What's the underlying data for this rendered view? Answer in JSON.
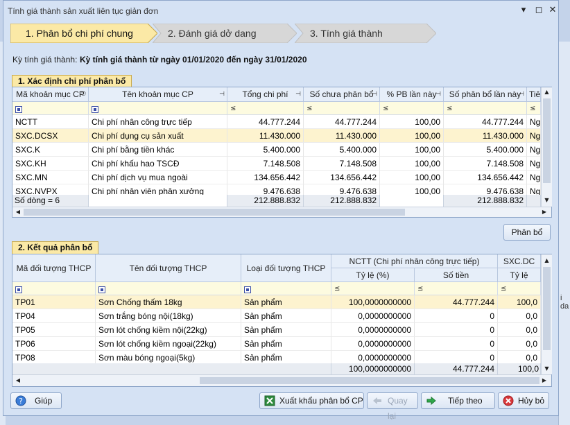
{
  "window": {
    "title": "Tính giá thành sản xuất liên tục giản đơn"
  },
  "steps": [
    {
      "label": "1. Phân bổ chi phí chung",
      "active": true
    },
    {
      "label": "2. Đánh giá dở dang",
      "active": false
    },
    {
      "label": "3. Tính giá thành",
      "active": false
    }
  ],
  "period": {
    "label": "Kỳ tính giá thành:",
    "value": "Kỳ tính giá thành từ ngày 01/01/2020 đến ngày 31/01/2020"
  },
  "section1": {
    "tab": "1. Xác định chi phí phân bổ",
    "columns": [
      "Mã khoản mục CP",
      "Tên khoản mục CP",
      "Tổng chi phí",
      "Số chưa phân bổ",
      "% PB lần này",
      "Số phân bổ lần này",
      "Tiê"
    ],
    "filter_op": "≤",
    "rows": [
      [
        "NCTT",
        "Chi phí nhân công trực tiếp",
        "44.777.244",
        "44.777.244",
        "100,00",
        "44.777.244",
        "Ngu"
      ],
      [
        "SXC.DCSX",
        "Chi phí dụng cụ sản xuất",
        "11.430.000",
        "11.430.000",
        "100,00",
        "11.430.000",
        "Ngu"
      ],
      [
        "SXC.K",
        "Chi phí bằng tiền khác",
        "5.400.000",
        "5.400.000",
        "100,00",
        "5.400.000",
        "Ngu"
      ],
      [
        "SXC.KH",
        "Chi phí khấu hao TSCĐ",
        "7.148.508",
        "7.148.508",
        "100,00",
        "7.148.508",
        "Ngu"
      ],
      [
        "SXC.MN",
        "Chi phí dịch vụ mua ngoài",
        "134.656.442",
        "134.656.442",
        "100,00",
        "134.656.442",
        "Ngu"
      ],
      [
        "SXC.NVPX",
        "Chi phí nhân viên phân xưởng",
        "9.476.638",
        "9.476.638",
        "100,00",
        "9.476.638",
        "Ngu"
      ]
    ],
    "footer": {
      "count": "Số dòng = 6",
      "total": "212.888.832",
      "unallocated": "212.888.832",
      "allocated": "212.888.832"
    }
  },
  "allocate_button": "Phân bổ",
  "section2": {
    "tab": "2. Kết quả phân bổ",
    "columns": [
      "Mã đối tượng THCP",
      "Tên đối tượng THCP",
      "Loại đối tượng THCP"
    ],
    "group1": {
      "title": "NCTT (Chi phí nhân công trực tiếp)",
      "sub": [
        "Tỷ lệ (%)",
        "Số tiền"
      ]
    },
    "group2": {
      "title": "SXC.DC",
      "sub": [
        "Tỷ lệ"
      ]
    },
    "filter_op": "≤",
    "rows": [
      [
        "TP01",
        "Sơn Chống thấm 18kg",
        "Sản phẩm",
        "100,0000000000",
        "44.777.244",
        "100,0"
      ],
      [
        "TP04",
        "Sơn trắng bóng nội(18kg)",
        "Sản phẩm",
        "0,0000000000",
        "0",
        "0,0"
      ],
      [
        "TP05",
        "Sơn lót chống kiềm nội(22kg)",
        "Sản phẩm",
        "0,0000000000",
        "0",
        "0,0"
      ],
      [
        "TP06",
        "Sơn lót chống kiềm ngoại(22kg)",
        "Sản phẩm",
        "0,0000000000",
        "0",
        "0,0"
      ],
      [
        "TP08",
        "Sơn màu bóng ngoại(5kg)",
        "Sản phẩm",
        "0,0000000000",
        "0",
        "0,0"
      ]
    ],
    "footer": {
      "rate": "100,0000000000",
      "amount": "44.777.244",
      "rate2": "100,0"
    }
  },
  "buttons": {
    "help": "Giúp",
    "export": "Xuất khẩu phân bổ CP",
    "back": "Quay lại",
    "next": "Tiếp theo",
    "cancel": "Hủy bỏ"
  },
  "background": {
    "right_text": "i da"
  },
  "colors": {
    "accent_tab": "#fbe9a6",
    "selected_row": "#fdf3cf",
    "window_bg": "#d5e2f4"
  }
}
